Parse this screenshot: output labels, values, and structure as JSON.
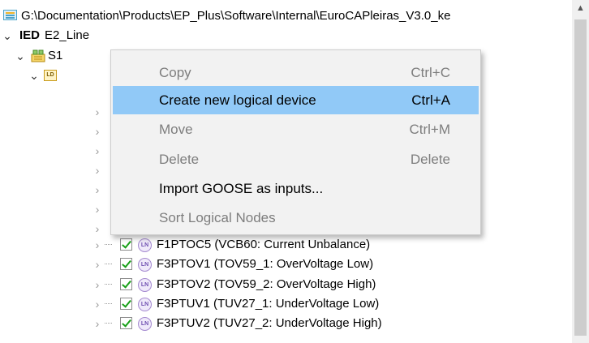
{
  "header": {
    "path": "G:\\Documentation\\Products\\EP_Plus\\Software\\Internal\\EuroCAPleiras_V3.0_ke"
  },
  "tree": {
    "ied": {
      "tag": "IED",
      "label": "E2_Line"
    },
    "substation": {
      "label": "S1"
    },
    "logical_device": {
      "icon_text": "LD"
    },
    "ln_icon_text": "LN",
    "nodes": [
      {
        "label": "F1PTOC5 (VCB60: Current Unbalance)"
      },
      {
        "label": "F3PTOV1 (TOV59_1: OverVoltage Low)"
      },
      {
        "label": "F3PTOV2 (TOV59_2: OverVoltage High)"
      },
      {
        "label": "F3PTUV1 (TUV27_1: UnderVoltage Low)"
      },
      {
        "label": "F3PTUV2 (TUV27_2: UnderVoltage High)"
      }
    ]
  },
  "context_menu": {
    "items": [
      {
        "label": "Copy",
        "shortcut": "Ctrl+C",
        "enabled": false,
        "highlighted": false
      },
      {
        "label": "Create new logical device",
        "shortcut": "Ctrl+A",
        "enabled": true,
        "highlighted": true
      },
      {
        "label": "Move",
        "shortcut": "Ctrl+M",
        "enabled": false,
        "highlighted": false
      },
      {
        "label": "Delete",
        "shortcut": "Delete",
        "enabled": false,
        "highlighted": false
      },
      {
        "label": "Import GOOSE as inputs...",
        "shortcut": "",
        "enabled": true,
        "highlighted": false
      },
      {
        "label": "Sort Logical Nodes",
        "shortcut": "",
        "enabled": false,
        "highlighted": false
      }
    ]
  },
  "colors": {
    "menu_highlight": "#91c9f7",
    "checkmark": "#18a018",
    "disabled_text": "#7d7d7d"
  }
}
